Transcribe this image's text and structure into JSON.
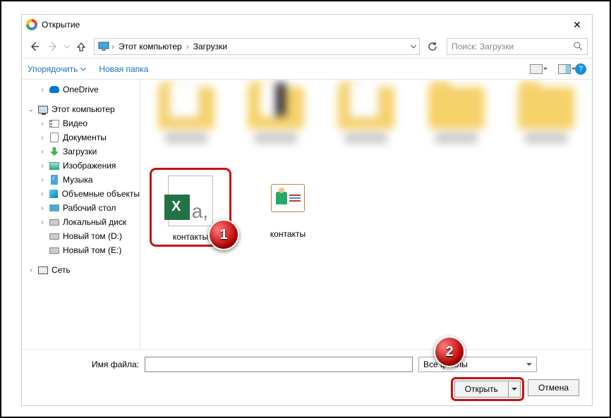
{
  "window": {
    "title": "Открытие"
  },
  "nav": {
    "crumb_root": "Этот компьютер",
    "crumb_folder": "Загрузки",
    "search_placeholder": "Поиск: Загрузки"
  },
  "toolbar": {
    "organize": "Упорядочить",
    "new_folder": "Новая папка"
  },
  "sidebar": {
    "items": [
      {
        "label": "OneDrive",
        "icon": "onedrive",
        "indent": 1,
        "expand": ">"
      },
      {
        "label": "Этот компьютер",
        "icon": "pc",
        "indent": 0,
        "expand": "v",
        "sp": true
      },
      {
        "label": "Видео",
        "icon": "vid",
        "indent": 1,
        "expand": ">"
      },
      {
        "label": "Документы",
        "icon": "doc",
        "indent": 1,
        "expand": ">"
      },
      {
        "label": "Загрузки",
        "icon": "down",
        "indent": 1,
        "expand": ">"
      },
      {
        "label": "Изображения",
        "icon": "pic",
        "indent": 1,
        "expand": ">"
      },
      {
        "label": "Музыка",
        "icon": "note",
        "indent": 1,
        "expand": ">"
      },
      {
        "label": "Объемные объекты",
        "icon": "3d",
        "indent": 1,
        "expand": ">"
      },
      {
        "label": "Рабочий стол",
        "icon": "desk",
        "indent": 1,
        "expand": ">"
      },
      {
        "label": "Локальный диск",
        "icon": "drive",
        "indent": 1,
        "expand": ">"
      },
      {
        "label": "Новый том (D:)",
        "icon": "drive",
        "indent": 1,
        "expand": ""
      },
      {
        "label": "Новый том (E:)",
        "icon": "drive",
        "indent": 1,
        "expand": ""
      },
      {
        "label": "Сеть",
        "icon": "net",
        "indent": 0,
        "expand": ">",
        "sp": true
      }
    ]
  },
  "files": {
    "selected": {
      "name": "контакты",
      "type": "csv"
    },
    "other": {
      "name": "контакты",
      "type": "vcard"
    }
  },
  "bottom": {
    "filename_label": "Имя файла:",
    "filename_value": "",
    "filetype": "Все файлы",
    "open": "Открыть",
    "cancel": "Отмена"
  },
  "badges": {
    "one": "1",
    "two": "2"
  }
}
